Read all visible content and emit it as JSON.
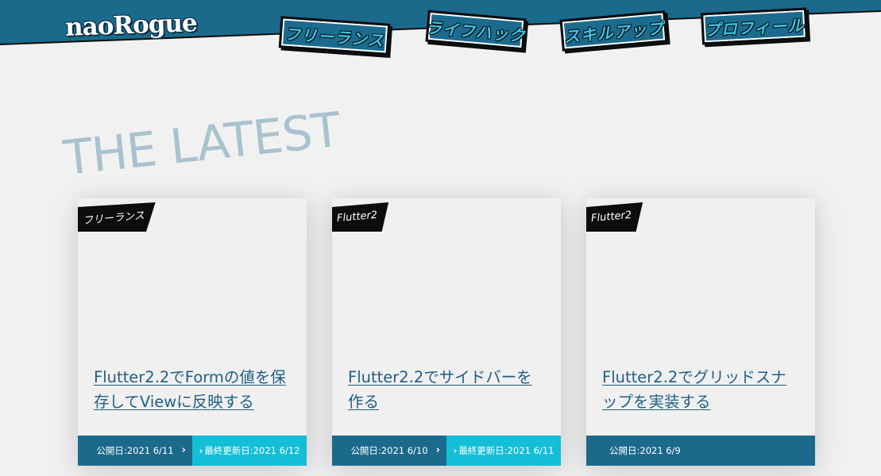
{
  "colors": {
    "brand_blue": "#1b6a8c",
    "accent_cyan": "#14bed6",
    "nav_text": "#39c6e8",
    "heading_faded": "#a9c2cf",
    "link": "#1f5e85",
    "background": "#f1f1f1"
  },
  "header": {
    "logo": "naoRogue",
    "nav": [
      {
        "label": "フリーランス"
      },
      {
        "label": "ライフハック"
      },
      {
        "label": "スキルアップ"
      },
      {
        "label": "プロフィール"
      }
    ]
  },
  "section": {
    "heading": "THE LATEST"
  },
  "cards": [
    {
      "tag": "フリーランス",
      "title": "Flutter2.2でFormの値を保存してViewに反映する",
      "published": "公開日:2021 6/11",
      "updated": "最終更新日:2021 6/12",
      "arrow_icon": "chevron-right-icon"
    },
    {
      "tag": "Flutter2",
      "title": "Flutter2.2でサイドバーを作る",
      "published": "公開日:2021 6/10",
      "updated": "最終更新日:2021 6/11",
      "arrow_icon": "chevron-right-icon"
    },
    {
      "tag": "Flutter2",
      "title": "Flutter2.2でグリッドスナップを実装する",
      "published": "公開日:2021 6/9"
    }
  ]
}
